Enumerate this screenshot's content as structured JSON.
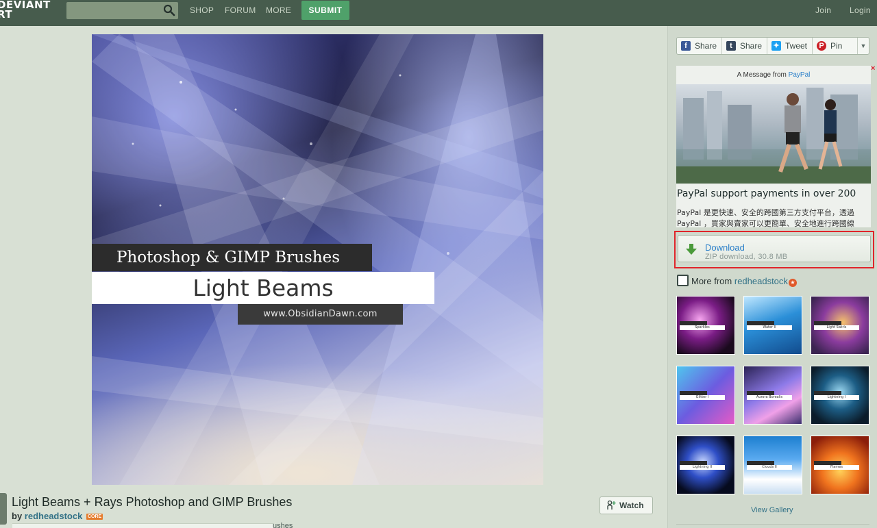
{
  "nav": {
    "logo_line1": "DEVIANT",
    "logo_line2": "RT",
    "search_placeholder": "",
    "shop": "SHOP",
    "forum": "FORUM",
    "more": "MORE",
    "submit": "SUBMIT",
    "join": "Join",
    "login": "Login"
  },
  "artwork": {
    "band1": "Photoshop & GIMP Brushes",
    "band2": "Light Beams",
    "band3": "www.ObsidianDawn.com"
  },
  "deviation": {
    "title": "Light Beams + Rays Photoshop and GIMP Brushes",
    "by_label": "by",
    "author": "redheadstock",
    "core_badge": "CORE",
    "description_fragment": "ushes",
    "watch": "Watch"
  },
  "share": {
    "facebook": "Share",
    "tumblr": "Share",
    "twitter": "Tweet",
    "pinterest": "Pin"
  },
  "ad": {
    "header_prefix": "A Message from",
    "header_brand": "PayPal",
    "close": "×",
    "title": "PayPal support payments in over 200",
    "text_line1": "PayPal 是更快速、安全的跨國第三方支付平台，透過",
    "text_line2": "PayPal ，買家與賣家可以更簡單、安全地進行跨國線"
  },
  "download": {
    "label": "Download",
    "sub": "ZIP download, 30.8 MB"
  },
  "more_from": {
    "prefix": "More from",
    "author": "redheadstock",
    "thumbs": [
      {
        "label": "Sparkles"
      },
      {
        "label": "Water II"
      },
      {
        "label": "Light Swirls"
      },
      {
        "label": "Glitter I"
      },
      {
        "label": "Aurora Borealis"
      },
      {
        "label": "Lightning I"
      },
      {
        "label": "Lightning II"
      },
      {
        "label": "Clouds II"
      },
      {
        "label": "Flames"
      }
    ],
    "view_gallery": "View Gallery"
  },
  "colors": {
    "topbar": "#475c4d",
    "submit": "#4fa16a",
    "link": "#337287",
    "highlight_border": "#e0242a"
  }
}
